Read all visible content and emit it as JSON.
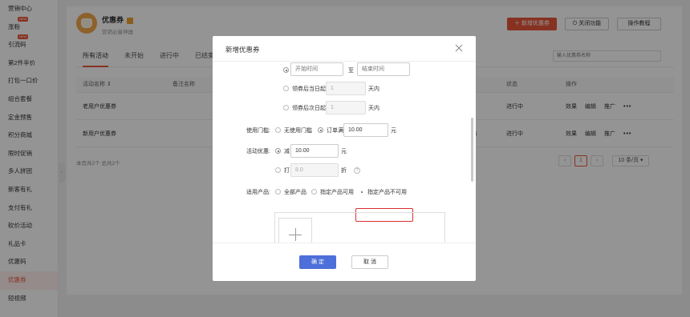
{
  "sidebar": {
    "items": [
      {
        "label": "营销中心",
        "badge": ""
      },
      {
        "label": "涨粉",
        "badge": "NEW"
      },
      {
        "label": "引流码",
        "badge": "NEW"
      },
      {
        "label": "第2件半价",
        "badge": ""
      },
      {
        "label": "打包一口价",
        "badge": ""
      },
      {
        "label": "组合套餐",
        "badge": ""
      },
      {
        "label": "定金预售",
        "badge": ""
      },
      {
        "label": "积分商城",
        "badge": ""
      },
      {
        "label": "限时促销",
        "badge": ""
      },
      {
        "label": "多人拼团",
        "badge": ""
      },
      {
        "label": "新客有礼",
        "badge": ""
      },
      {
        "label": "支付有礼",
        "badge": ""
      },
      {
        "label": "砍价活动",
        "badge": ""
      },
      {
        "label": "礼品卡",
        "badge": ""
      },
      {
        "label": "优惠码",
        "badge": ""
      },
      {
        "label": "优惠券",
        "badge": "",
        "active": true
      },
      {
        "label": "短视频",
        "badge": ""
      }
    ],
    "collapse_glyph": "‹"
  },
  "header": {
    "title": "优惠券",
    "subtitle": "营销必备神器",
    "new_button": "＋ 新增优惠券",
    "disable_button": "关闭功能",
    "tutorial_button": "操作教程"
  },
  "tabs": [
    {
      "label": "所有活动",
      "active": true
    },
    {
      "label": "未开始"
    },
    {
      "label": "进行中"
    },
    {
      "label": "已结束"
    }
  ],
  "search": {
    "placeholder": "输入优惠券名称"
  },
  "table": {
    "headers": {
      "name": "活动名称 ⇕",
      "remark": "备注名称",
      "status": "状态",
      "actions": "操作"
    },
    "rows": [
      {
        "name": "老用户优惠券",
        "status": "进行中",
        "extra": ""
      },
      {
        "name": "新用户优惠券",
        "status": "进行中",
        "extra": "1"
      }
    ],
    "row_actions": {
      "effect": "效果",
      "edit": "编辑",
      "promote": "推广",
      "more": "•••"
    },
    "summary": "本页共2个 总共2个"
  },
  "pagination": {
    "prev": "‹",
    "current": "1",
    "next": "›",
    "page_size": "10 条/页 ▾"
  },
  "modal": {
    "title": "新增优惠券",
    "close_glyph": "×",
    "validity": {
      "start_placeholder": "开始时间",
      "to": "至",
      "end_placeholder": "结束时间",
      "opt_same_day": "领券后当日起",
      "opt_next_day": "领券后次日起",
      "days_value_1": "1",
      "days_value_2": "1",
      "days_unit": "天内"
    },
    "threshold": {
      "label": "使用门槛:",
      "opt_none": "无使用门槛",
      "opt_full": "订单满",
      "value": "10.00",
      "unit": "元"
    },
    "discount": {
      "label": "活动优惠:",
      "opt_reduce": "减",
      "reduce_value": "10.00",
      "reduce_unit": "元",
      "opt_discount": "打",
      "discount_value": "8.0",
      "discount_unit": "折",
      "help": "?"
    },
    "products": {
      "label": "适用产品:",
      "opt_all": "全部产品",
      "opt_specific": "指定产品可用",
      "opt_exclude": "指定产品不可用"
    },
    "ok": "确 定",
    "cancel": "取 消"
  },
  "colors": {
    "accent": "#e8563a",
    "primary": "#4d6fd9",
    "highlight": "#d9302b"
  }
}
